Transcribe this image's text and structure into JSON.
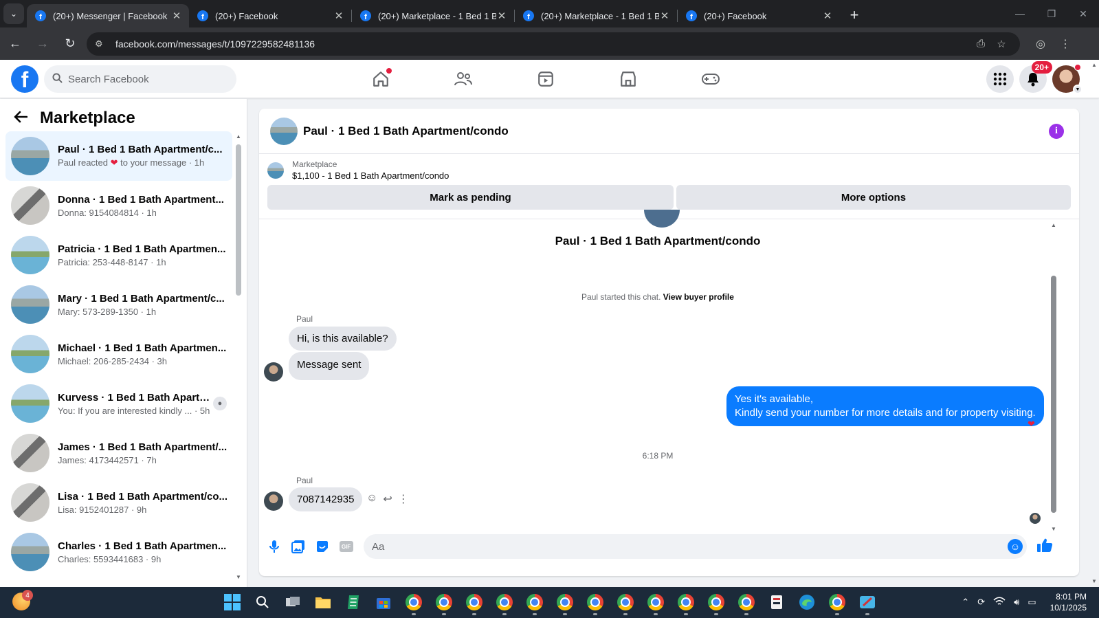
{
  "browser": {
    "tabs": [
      {
        "title": "(20+) Messenger | Facebook",
        "active": true
      },
      {
        "title": "(20+) Facebook",
        "active": false
      },
      {
        "title": "(20+) Marketplace - 1 Bed 1 Ba",
        "active": false
      },
      {
        "title": "(20+) Marketplace - 1 Bed 1 Ba",
        "active": false
      },
      {
        "title": "(20+) Facebook",
        "active": false
      }
    ],
    "url": "facebook.com/messages/t/1097229582481136"
  },
  "header": {
    "search_placeholder": "Search Facebook",
    "notifications_badge": "20+"
  },
  "sidebar": {
    "title": "Marketplace",
    "conversations": [
      {
        "name": "Paul · 1 Bed 1 Bath Apartment/c...",
        "preview_a": "Paul reacted ",
        "preview_b": " to your message · 1h",
        "thumb": "a"
      },
      {
        "name": "Donna · 1 Bed 1 Bath Apartment...",
        "preview": "Donna: 9154084814 · 1h",
        "thumb": "b"
      },
      {
        "name": "Patricia · 1 Bed 1 Bath Apartmen...",
        "preview": "Patricia: 253-448-8147 · 1h",
        "thumb": "c"
      },
      {
        "name": "Mary · 1 Bed 1 Bath Apartment/c...",
        "preview": "Mary: 573-289-1350 · 1h",
        "thumb": "a"
      },
      {
        "name": "Michael · 1 Bed 1 Bath Apartmen...",
        "preview": "Michael: 206-285-2434 · 3h",
        "thumb": "c"
      },
      {
        "name": "Kurvess · 1 Bed 1 Bath Apartm...",
        "preview": "You: If you are interested kindly ... · 5h",
        "thumb": "c"
      },
      {
        "name": "James · 1 Bed 1 Bath Apartment/...",
        "preview": "James: 4173442571 · 7h",
        "thumb": "b"
      },
      {
        "name": "Lisa · 1 Bed 1 Bath Apartment/co...",
        "preview": "Lisa: 9152401287 · 9h",
        "thumb": "b"
      },
      {
        "name": "Charles · 1 Bed 1 Bath Apartmen...",
        "preview": "Charles: 5593441683 · 9h",
        "thumb": "a"
      }
    ]
  },
  "chat": {
    "title": "Paul · 1 Bed 1 Bath Apartment/condo",
    "marketplace_label": "Marketplace",
    "listing": "$1,100 - 1 Bed 1 Bath Apartment/condo",
    "mark_pending": "Mark as pending",
    "more_options": "More options",
    "convo_title": "Paul · 1 Bed 1 Bath Apartment/condo",
    "started_text": "Paul started this chat. ",
    "view_buyer_profile": "View buyer profile",
    "sender_name": "Paul",
    "msg1": "Hi, is this available?",
    "msg2": "Message sent",
    "reply_line1": "Yes it's available,",
    "reply_line2": "Kindly send your number for more details and for property visiting.",
    "timestamp": "6:18 PM",
    "msg3": "7087142935",
    "composer_placeholder": "Aa"
  },
  "taskbar": {
    "widget_badge": "4",
    "time": "8:01 PM",
    "date": "10/1/2025"
  },
  "colors": {
    "fb_blue": "#1877f2",
    "outgoing_bubble": "#0a7cff",
    "notification_red": "#e41e3f",
    "info_purple": "#9b31e8"
  }
}
